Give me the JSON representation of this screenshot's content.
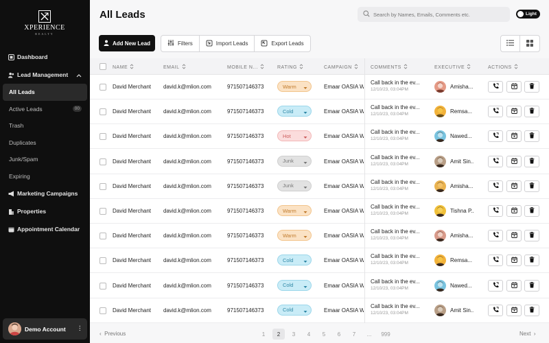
{
  "brand": {
    "mark": "XR",
    "name": "XPERIENCE",
    "sub": "REALTY"
  },
  "sidebar": {
    "items": [
      {
        "label": "Dashboard",
        "icon": "dashboard-icon"
      },
      {
        "label": "Lead Management",
        "icon": "users-icon",
        "expanded": true
      },
      {
        "label": "Marketing Campaigns",
        "icon": "megaphone-icon"
      },
      {
        "label": "Properties",
        "icon": "building-icon"
      },
      {
        "label": "Appointment Calendar",
        "icon": "calendar-icon"
      }
    ],
    "sub_items": [
      {
        "label": "All Leads",
        "active": true
      },
      {
        "label": "Active Leads",
        "badge": "00"
      },
      {
        "label": "Trash"
      },
      {
        "label": "Duplicates"
      },
      {
        "label": "Junk/Spam"
      },
      {
        "label": "Expiring"
      }
    ],
    "account": {
      "name": "Demo Account"
    }
  },
  "header": {
    "title": "All Leads",
    "search_placeholder": "Search by Names, Emails, Comments etc.",
    "theme_label": "Light"
  },
  "toolbar": {
    "add_label": "Add New Lead",
    "filters_label": "Filters",
    "import_label": "Import Leads",
    "export_label": "Export Leads"
  },
  "table": {
    "columns": [
      "NAME",
      "EMAIL",
      "MOBILE N...",
      "RATING",
      "CAMPAIGN",
      "COMMENTS",
      "EXECUTIVE",
      "ACTIONS"
    ],
    "rows": [
      {
        "name": "David Merchant",
        "email": "david.k@mlion.com",
        "mobile": "971507146373",
        "rating": "Warm",
        "campaign": "Emaar OASIA W",
        "comment": "Call back in the ev...",
        "date": "12/10/23, 03:04PM",
        "exec": "Amisha..."
      },
      {
        "name": "David Merchant",
        "email": "david.k@mlion.com",
        "mobile": "971507146373",
        "rating": "Cold",
        "campaign": "Emaar OASIA W",
        "comment": "Call back in the ev...",
        "date": "12/10/23, 03:04PM",
        "exec": "Remsa..."
      },
      {
        "name": "David Merchant",
        "email": "david.k@mlion.com",
        "mobile": "971507146373",
        "rating": "Hot",
        "campaign": "Emaar OASIA W",
        "comment": "Call back in the ev...",
        "date": "12/10/23, 03:04PM",
        "exec": "Nawed..."
      },
      {
        "name": "David Merchant",
        "email": "david.k@mlion.com",
        "mobile": "971507146373",
        "rating": "Junk",
        "campaign": "Emaar OASIA W",
        "comment": "Call back in the ev...",
        "date": "12/10/23, 03:04PM",
        "exec": "Amit Sin..."
      },
      {
        "name": "David Merchant",
        "email": "david.k@mlion.com",
        "mobile": "971507146373",
        "rating": "Junk",
        "campaign": "Emaar OASIA W",
        "comment": "Call back in the ev...",
        "date": "12/10/23, 03:04PM",
        "exec": "Amisha..."
      },
      {
        "name": "David Merchant",
        "email": "david.k@mlion.com",
        "mobile": "971507146373",
        "rating": "Warm",
        "campaign": "Emaar OASIA W",
        "comment": "Call back in the ev...",
        "date": "12/10/23, 03:04PM",
        "exec": "Tishna P..."
      },
      {
        "name": "David Merchant",
        "email": "david.k@mlion.com",
        "mobile": "971507146373",
        "rating": "Warm",
        "campaign": "Emaar OASIA W",
        "comment": "Call back in the ev...",
        "date": "12/10/23, 03:04PM",
        "exec": "Amisha..."
      },
      {
        "name": "David Merchant",
        "email": "david.k@mlion.com",
        "mobile": "971507146373",
        "rating": "Cold",
        "campaign": "Emaar OASIA W",
        "comment": "Call back in the ev...",
        "date": "12/10/23, 03:04PM",
        "exec": "Remsa..."
      },
      {
        "name": "David Merchant",
        "email": "david.k@mlion.com",
        "mobile": "971507146373",
        "rating": "Cold",
        "campaign": "Emaar OASIA W",
        "comment": "Call back in the ev...",
        "date": "12/10/23, 03:04PM",
        "exec": "Nawed..."
      },
      {
        "name": "David Merchant",
        "email": "david.k@mlion.com",
        "mobile": "971507146373",
        "rating": "Cold",
        "campaign": "Emaar OASIA W",
        "comment": "Call back in the ev...",
        "date": "12/10/23, 03:04PM",
        "exec": "Amit Sin..."
      }
    ]
  },
  "pagination": {
    "prev_label": "Previous",
    "next_label": "Next",
    "pages": [
      "1",
      "2",
      "3",
      "4",
      "5",
      "6",
      "7",
      "...",
      "999"
    ],
    "current": "2"
  },
  "colors": {
    "sidebar_bg": "#0f0f0f",
    "primary": "#111111",
    "warm": "#fbe2c4",
    "cold": "#c9ecf7",
    "hot": "#fbdcdc",
    "junk": "#e2e2e2"
  }
}
